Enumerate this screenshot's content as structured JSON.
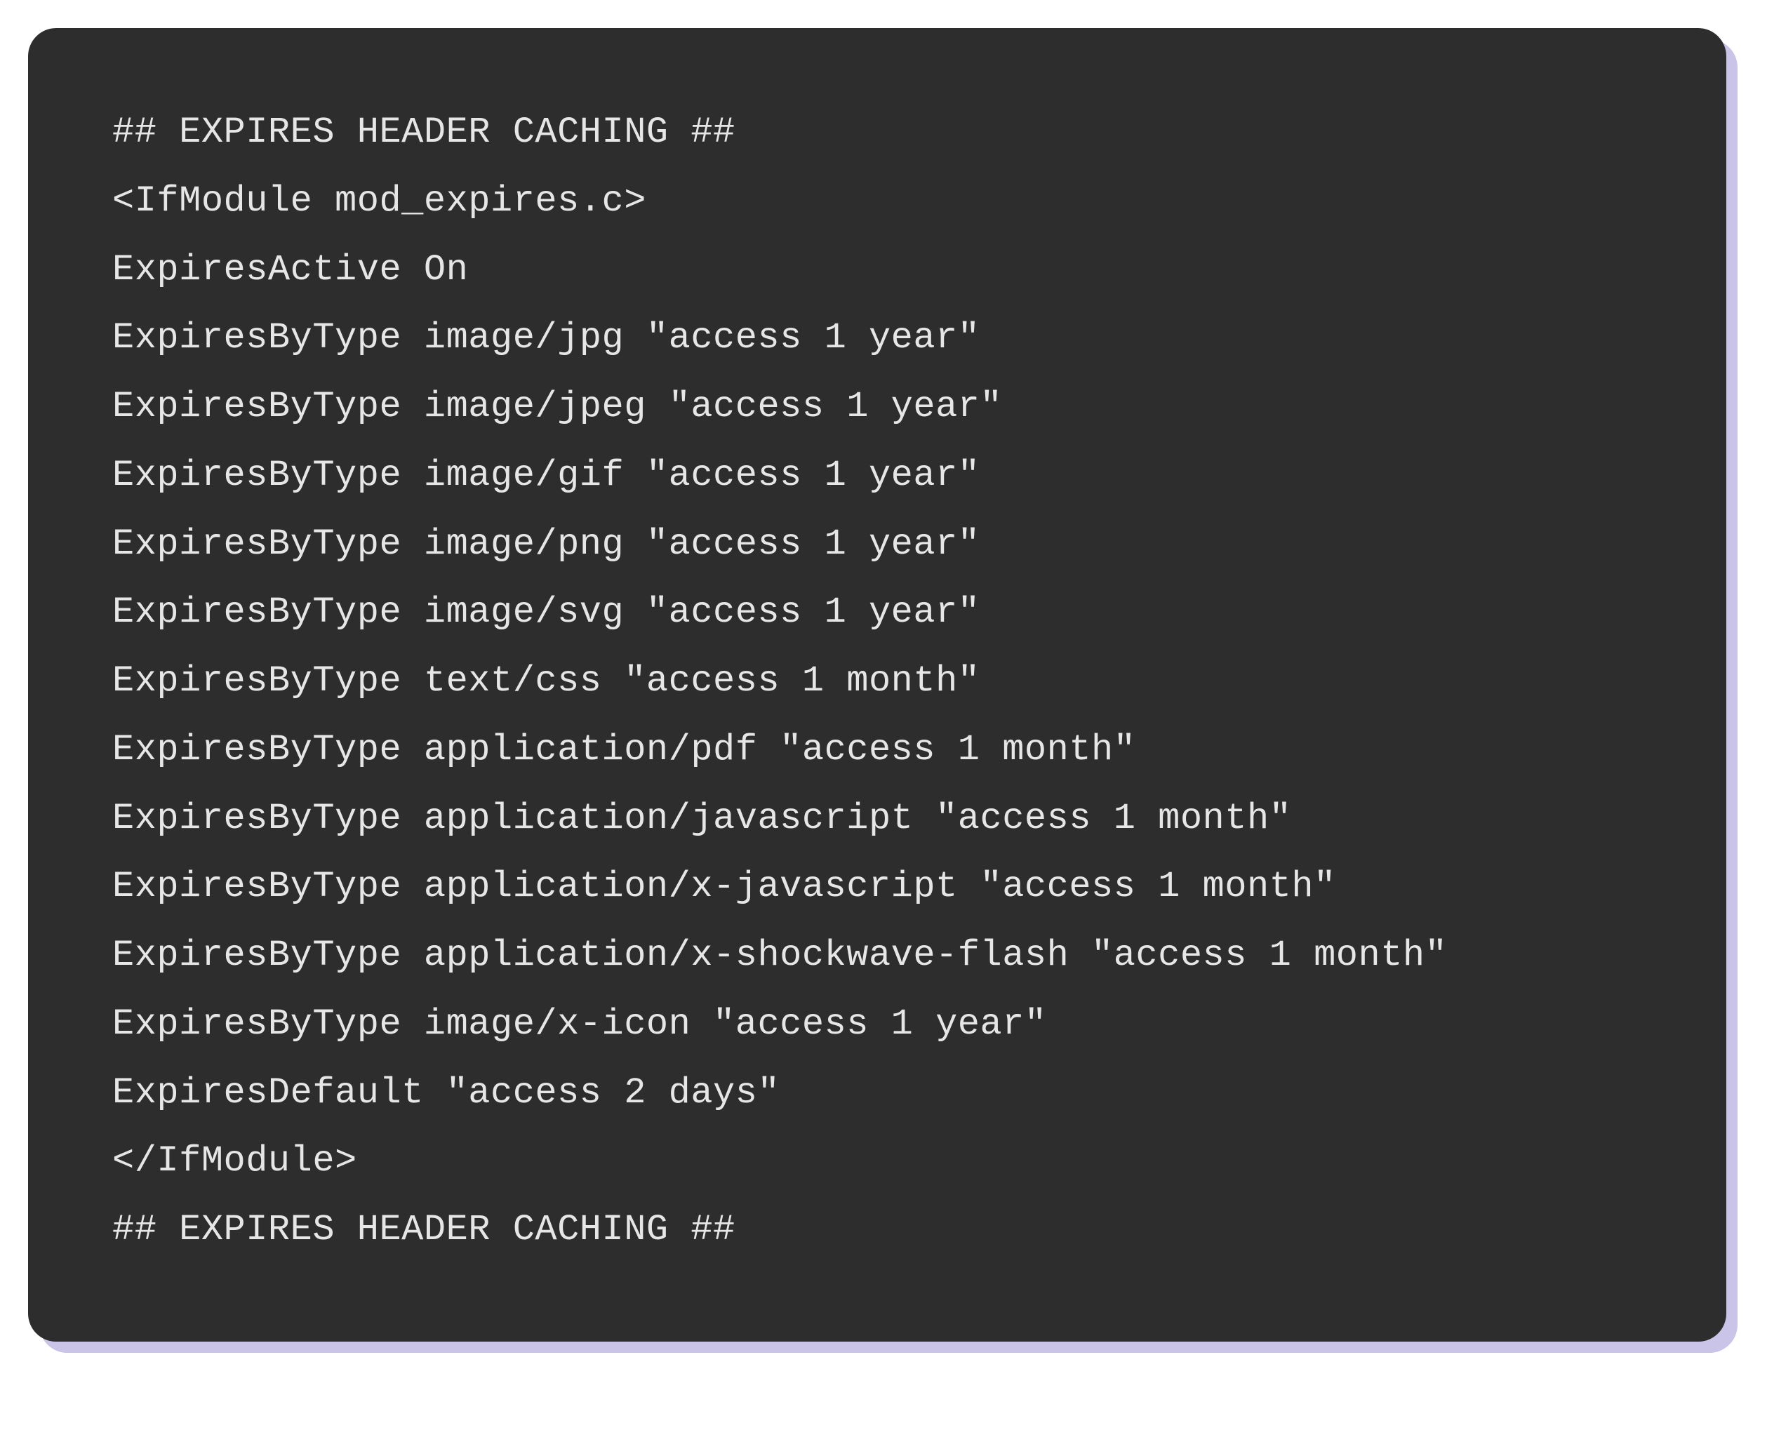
{
  "code": {
    "lines": [
      "## EXPIRES HEADER CACHING ##",
      "<IfModule mod_expires.c>",
      "ExpiresActive On",
      "ExpiresByType image/jpg \"access 1 year\"",
      "ExpiresByType image/jpeg \"access 1 year\"",
      "ExpiresByType image/gif \"access 1 year\"",
      "ExpiresByType image/png \"access 1 year\"",
      "ExpiresByType image/svg \"access 1 year\"",
      "ExpiresByType text/css \"access 1 month\"",
      "ExpiresByType application/pdf \"access 1 month\"",
      "ExpiresByType application/javascript \"access 1 month\"",
      "ExpiresByType application/x-javascript \"access 1 month\"",
      "ExpiresByType application/x-shockwave-flash \"access 1 month\"",
      "ExpiresByType image/x-icon \"access 1 year\"",
      "ExpiresDefault \"access 2 days\"",
      "</IfModule>",
      "## EXPIRES HEADER CACHING ##"
    ]
  }
}
